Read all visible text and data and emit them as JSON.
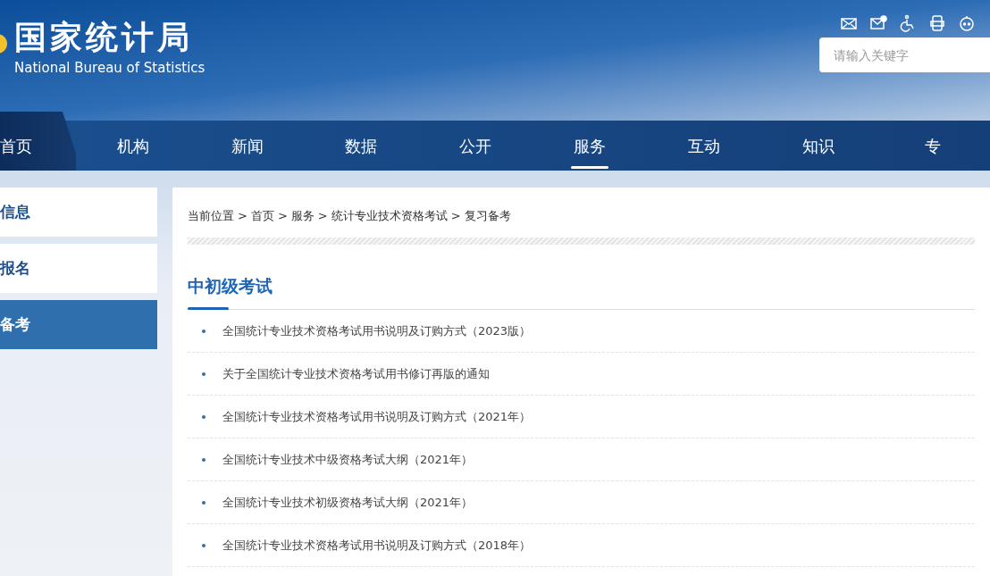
{
  "logo": {
    "title": "国家统计局",
    "subtitle": "National Bureau of Statistics"
  },
  "search": {
    "placeholder": "请输入关键字"
  },
  "nav": [
    {
      "label": "首页",
      "selected": false,
      "kind": "home"
    },
    {
      "label": "机构",
      "selected": false,
      "kind": "link"
    },
    {
      "label": "新闻",
      "selected": false,
      "kind": "link"
    },
    {
      "label": "数据",
      "selected": false,
      "kind": "link"
    },
    {
      "label": "公开",
      "selected": false,
      "kind": "link"
    },
    {
      "label": "服务",
      "selected": true,
      "kind": "link"
    },
    {
      "label": "互动",
      "selected": false,
      "kind": "link"
    },
    {
      "label": "知识",
      "selected": false,
      "kind": "link"
    },
    {
      "label": "专",
      "selected": false,
      "kind": "link"
    }
  ],
  "sidebar": [
    {
      "label": "信息",
      "selected": false
    },
    {
      "label": "报名",
      "selected": false
    },
    {
      "label": "备考",
      "selected": true
    }
  ],
  "breadcrumb": {
    "prefix": "当前位置",
    "items": [
      "首页",
      "服务",
      "统计专业技术资格考试",
      "复习备考"
    ],
    "separator": ">"
  },
  "section_title": "中初级考试",
  "articles": [
    "全国统计专业技术资格考试用书说明及订购方式（2023版）",
    "关于全国统计专业技术资格考试用书修订再版的通知",
    "全国统计专业技术资格考试用书说明及订购方式（2021年）",
    "全国统计专业技术中级资格考试大纲（2021年）",
    "全国统计专业技术初级资格考试大纲（2021年）",
    "全国统计专业技术资格考试用书说明及订购方式（2018年）"
  ]
}
